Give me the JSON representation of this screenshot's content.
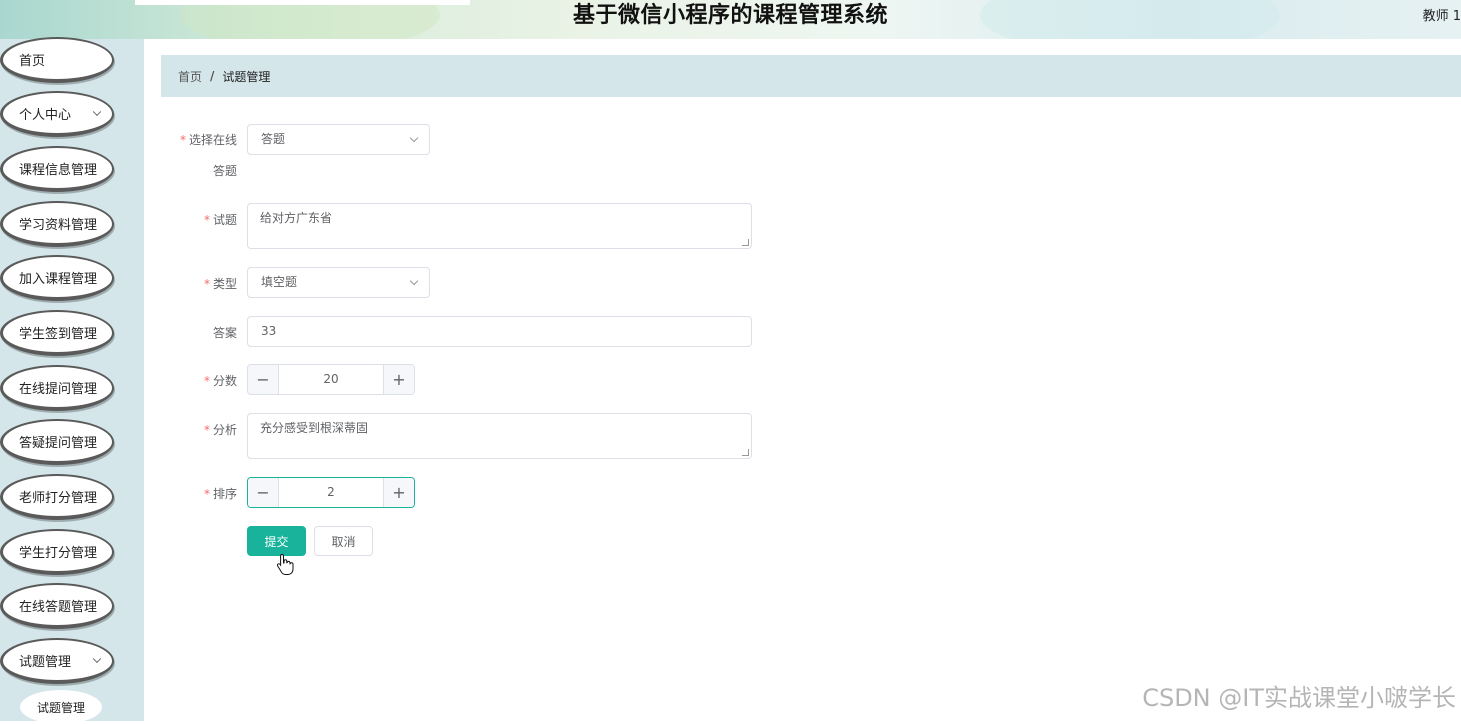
{
  "header": {
    "title": "基于微信小程序的课程管理系统",
    "user": "教师 1"
  },
  "sidebar": {
    "items": [
      {
        "label": "首页",
        "has_arrow": false
      },
      {
        "label": "个人中心",
        "has_arrow": true
      },
      {
        "label": "课程信息管理",
        "has_arrow": false
      },
      {
        "label": "学习资料管理",
        "has_arrow": false
      },
      {
        "label": "加入课程管理",
        "has_arrow": false
      },
      {
        "label": "学生签到管理",
        "has_arrow": false
      },
      {
        "label": "在线提问管理",
        "has_arrow": false
      },
      {
        "label": "答疑提问管理",
        "has_arrow": false
      },
      {
        "label": "老师打分管理",
        "has_arrow": false
      },
      {
        "label": "学生打分管理",
        "has_arrow": false
      },
      {
        "label": "在线答题管理",
        "has_arrow": false
      },
      {
        "label": "试题管理",
        "has_arrow": true
      }
    ],
    "subitem": "试题管理"
  },
  "breadcrumb": {
    "home": "首页",
    "separator": "/",
    "current": "试题管理"
  },
  "form": {
    "exam_label_line1": "选择在线",
    "exam_label_line2": "答题",
    "exam_value": "答题",
    "question_label": "试题",
    "question_value": "给对方广东省",
    "type_label": "类型",
    "type_value": "填空题",
    "answer_label": "答案",
    "answer_value": "33",
    "score_label": "分数",
    "score_value": "20",
    "analysis_label": "分析",
    "analysis_value": "充分感受到根深蒂固",
    "order_label": "排序",
    "order_value": "2",
    "required_mark": "*",
    "minus": "−",
    "plus": "+"
  },
  "buttons": {
    "submit": "提交",
    "cancel": "取消"
  },
  "colors": {
    "accent": "#19b39b",
    "sidebar_bg": "#d4e6ea",
    "required": "#f56c6c"
  },
  "watermark": "CSDN @IT实战课堂小啵学长"
}
